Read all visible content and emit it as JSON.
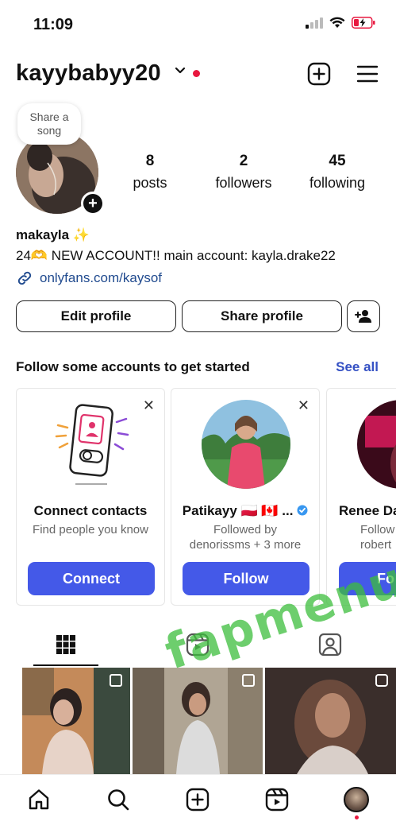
{
  "status_bar": {
    "time": "11:09"
  },
  "header": {
    "username": "kayybabyy20"
  },
  "note": {
    "text_line1": "Share a",
    "text_line2": "song"
  },
  "stats": [
    {
      "value": "8",
      "label": "posts"
    },
    {
      "value": "2",
      "label": "followers"
    },
    {
      "value": "45",
      "label": "following"
    }
  ],
  "profile": {
    "display_name": "makayla ✨",
    "bio": "24🫶 NEW ACCOUNT!! main account: kayla.drake22",
    "link": "onlyfans.com/kaysof"
  },
  "actions": {
    "edit_profile": "Edit profile",
    "share_profile": "Share profile"
  },
  "suggestions": {
    "title": "Follow some accounts to get started",
    "see_all": "See all",
    "cards": [
      {
        "name": "Connect contacts",
        "sub_line1": "Find people you know",
        "sub_line2": "",
        "button": "Connect"
      },
      {
        "name": "Patikayy 🇵🇱 🇨🇦 ...",
        "sub_line1": "Followed by",
        "sub_line2": "denorissms + 3 more",
        "button": "Follow"
      },
      {
        "name": "Renee Da",
        "sub_line1": "Follow",
        "sub_line2": "robert",
        "button": "Fo"
      }
    ]
  },
  "watermark": "fapmenu.com",
  "colors": {
    "accent": "#4459e8",
    "link": "#214b8f",
    "see_all": "#3551c4",
    "notification": "#e8183f"
  }
}
